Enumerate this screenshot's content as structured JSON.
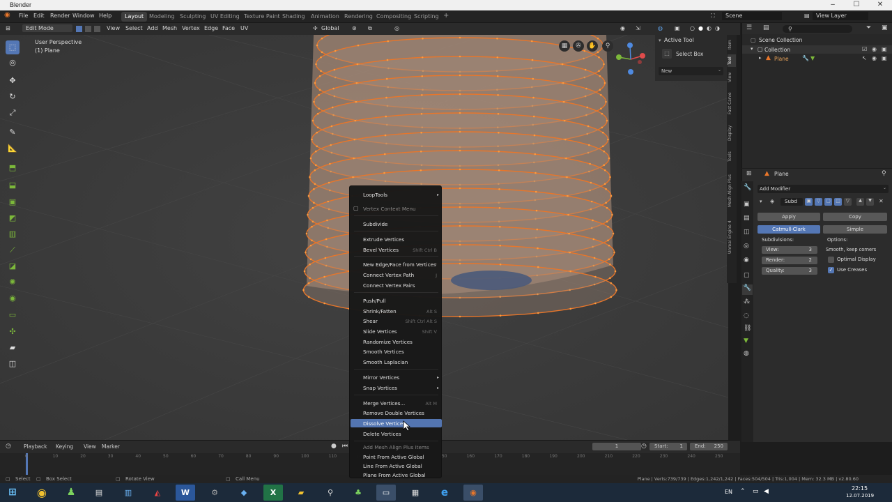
{
  "window": {
    "title": "Blender"
  },
  "menubar": {
    "items": [
      "File",
      "Edit",
      "Render",
      "Window",
      "Help"
    ]
  },
  "workspaces": {
    "tabs": [
      "Layout",
      "Modeling",
      "Sculpting",
      "UV Editing",
      "Texture Paint",
      "Shading",
      "Animation",
      "Rendering",
      "Compositing",
      "Scripting"
    ],
    "active": "Layout"
  },
  "scene": {
    "name": "Scene",
    "view_layer": "View Layer"
  },
  "viewport_header": {
    "mode": "Edit Mode",
    "menus": [
      "View",
      "Select",
      "Add",
      "Mesh",
      "Vertex",
      "Edge",
      "Face",
      "UV"
    ],
    "transform_orientation": "Global"
  },
  "viewport": {
    "view_name": "User Perspective",
    "object_name": "(1) Plane"
  },
  "sidebar": {
    "title": "Active Tool",
    "tool": "Select Box",
    "dropdown": "New",
    "tabs": [
      "Item",
      "Tool",
      "View",
      "Fast Carve",
      "Display",
      "Tools",
      "Mesh Align Plus",
      "Unreal Engine 4"
    ]
  },
  "outliner": {
    "root": "Scene Collection",
    "collection": "Collection",
    "object": "Plane"
  },
  "properties": {
    "object": "Plane",
    "add_modifier": "Add Modifier",
    "modifier_name": "Subd",
    "apply": "Apply",
    "copy": "Copy",
    "catmull": "Catmull-Clark",
    "simple": "Simple",
    "subdivisions_label": "Subdivisions:",
    "options_label": "Options:",
    "view_label": "View:",
    "view_value": "3",
    "render_label": "Render:",
    "render_value": "2",
    "quality_label": "Quality:",
    "quality_value": "3",
    "uv_smooth": "Smooth, keep corners",
    "optimal_display": "Optimal Display",
    "use_creases": "Use Creases"
  },
  "context_menu": {
    "items": [
      {
        "label": "LoopTools",
        "submenu": true
      },
      {
        "label": "Vertex Context Menu",
        "dim": true
      },
      {
        "label": "Subdivide"
      },
      {
        "label": "Extrude Vertices"
      },
      {
        "label": "Bevel Vertices",
        "shortcut": "Shift Ctrl B"
      },
      {
        "label": "New Edge/Face from Vertices",
        "shortcut": "F"
      },
      {
        "label": "Connect Vertex Path",
        "shortcut": "J"
      },
      {
        "label": "Connect Vertex Pairs"
      },
      {
        "label": "Push/Pull"
      },
      {
        "label": "Shrink/Fatten",
        "shortcut": "Alt S"
      },
      {
        "label": "Shear",
        "shortcut": "Shift Ctrl Alt S"
      },
      {
        "label": "Slide Vertices",
        "shortcut": "Shift V"
      },
      {
        "label": "Randomize Vertices"
      },
      {
        "label": "Smooth Vertices"
      },
      {
        "label": "Smooth Laplacian"
      },
      {
        "label": "Mirror Vertices",
        "submenu": true
      },
      {
        "label": "Snap Vertices",
        "submenu": true
      },
      {
        "label": "Merge Vertices...",
        "shortcut": "Alt M"
      },
      {
        "label": "Remove Double Vertices"
      },
      {
        "label": "Dissolve Vertices",
        "highlighted": true
      },
      {
        "label": "Delete Vertices"
      },
      {
        "label": "Add Mesh Align Plus items",
        "dim": true
      },
      {
        "label": "Point From Active Global"
      },
      {
        "label": "Line From Active Global"
      },
      {
        "label": "Plane From Active Global"
      }
    ]
  },
  "timeline": {
    "menus": [
      "Playback",
      "Keying",
      "View",
      "Marker"
    ],
    "current_frame": "1",
    "start_label": "Start:",
    "start": "1",
    "end_label": "End:",
    "end": "250",
    "ticks": [
      "0",
      "10",
      "20",
      "30",
      "40",
      "50",
      "60",
      "70",
      "80",
      "90",
      "100",
      "110",
      "120",
      "130",
      "140",
      "150",
      "160",
      "170",
      "180",
      "190",
      "200",
      "210",
      "220",
      "230",
      "240",
      "250"
    ]
  },
  "statusbar": {
    "select": "Select",
    "box_select": "Box Select",
    "rotate_view": "Rotate View",
    "call_menu": "Call Menu",
    "stats": "Plane | Verts:739/739 | Edges:1,242/1,242 | Faces:504/504 | Tris:1,004 | Mem: 32.3 MB | v2.80.60"
  },
  "taskbar": {
    "lang": "EN",
    "time": "22:15",
    "date": "12.07.2019"
  },
  "colors": {
    "accent": "#5477b5",
    "mesh_edge": "#e8762a",
    "mesh_fill": "#8a7466"
  }
}
